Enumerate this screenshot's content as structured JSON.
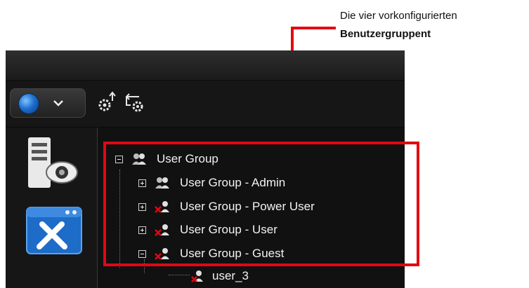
{
  "annotation": {
    "line1": "Die vier vorkonfigurierten",
    "line2": "Benutzergruppent"
  },
  "toolbar": {
    "globe_icon": "globe-icon",
    "dropdown_icon": "chevron-down-icon",
    "tools": [
      "settings-export-icon",
      "settings-import-icon"
    ]
  },
  "left_rail": {
    "items": [
      "server-monitor-icon",
      "window-tools-icon"
    ]
  },
  "tree": {
    "root": {
      "label": "User Group",
      "expanded": true
    },
    "children": [
      {
        "label": "User Group - Admin",
        "expanded": false
      },
      {
        "label": "User Group - Power User",
        "expanded": false
      },
      {
        "label": "User Group - User",
        "expanded": false
      },
      {
        "label": "User Group - Guest",
        "expanded": true
      }
    ],
    "leaf": {
      "label": "user_3"
    }
  },
  "colors": {
    "highlight": "#e30613",
    "panel_bg": "#111111",
    "text": "#f2f2f2"
  }
}
